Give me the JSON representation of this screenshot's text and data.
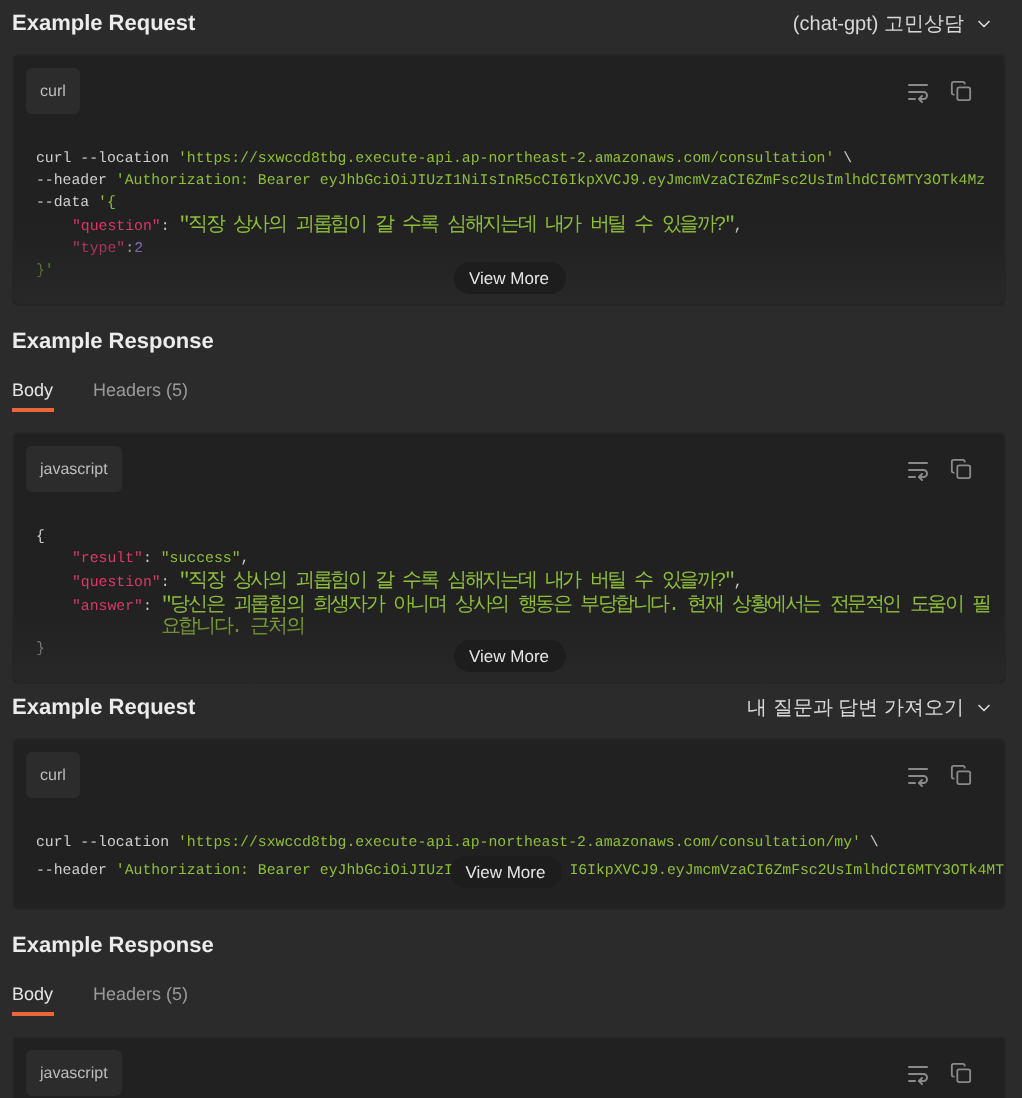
{
  "sections": [
    {
      "kind": "request",
      "title": "Example Request",
      "selector": {
        "label": "(chat-gpt) 고민상담"
      },
      "block": {
        "language": "curl",
        "view_more": "View More",
        "lines": [
          {
            "indented": false,
            "parts": [
              [
                {
                  "kind": "plain",
                  "text": "curl --location "
                },
                {
                  "kind": "str",
                  "text": "'https://sxwccd8tbg.execute-api.ap-northeast-2.amazonaws.com/consultation'"
                },
                {
                  "kind": "plain",
                  "text": " \\"
                }
              ]
            ]
          },
          {
            "indented": false,
            "parts": [
              [
                {
                  "kind": "plain",
                  "text": "--header "
                },
                {
                  "kind": "str",
                  "text": "'Authorization: Bearer eyJhbGciOiJIUzI1NiIsInR5cCI6IkpXVCJ9.eyJmcmVzaCI6ZmFsc2UsImlhdCI6MTY3OTk4Mz"
                }
              ]
            ]
          },
          {
            "indented": false,
            "parts": [
              [
                {
                  "kind": "plain",
                  "text": "--data "
                },
                {
                  "kind": "str",
                  "text": "'{"
                }
              ]
            ]
          },
          {
            "indented": true,
            "parts": [
              [
                {
                  "kind": "key",
                  "text": "\"question\""
                },
                {
                  "kind": "plain",
                  "text": ": "
                },
                {
                  "kind": "str",
                  "text": "\"직장 상사의 괴롭힘이 갈 수록 심해지는데 내가 버틸 수 있을까?\""
                },
                {
                  "kind": "plain",
                  "text": ","
                }
              ]
            ]
          },
          {
            "indented": true,
            "parts": [
              [
                {
                  "kind": "key",
                  "text": "\"type\""
                },
                {
                  "kind": "plain",
                  "text": ":"
                },
                {
                  "kind": "num",
                  "text": "2"
                }
              ]
            ]
          },
          {
            "indented": false,
            "parts": [
              [
                {
                  "kind": "str",
                  "text": "}'"
                }
              ]
            ]
          }
        ]
      }
    },
    {
      "kind": "response",
      "title": "Example Response",
      "tabs": [
        {
          "label": "Body",
          "selected": true
        },
        {
          "label": "Headers (5)",
          "selected": false
        }
      ],
      "block": {
        "language": "javascript",
        "view_more": "View More",
        "lines": [
          {
            "indented": false,
            "parts": [
              [
                {
                  "kind": "plain",
                  "text": "{"
                }
              ]
            ]
          },
          {
            "indented": true,
            "parts": [
              [
                {
                  "kind": "key",
                  "text": "\"result\""
                },
                {
                  "kind": "plain",
                  "text": ": "
                },
                {
                  "kind": "str",
                  "text": "\"success\""
                },
                {
                  "kind": "plain",
                  "text": ","
                }
              ]
            ]
          },
          {
            "indented": true,
            "parts": [
              [
                {
                  "kind": "key",
                  "text": "\"question\""
                },
                {
                  "kind": "plain",
                  "text": ": "
                },
                {
                  "kind": "str",
                  "text": "\"직장 상사의 괴롭힘이 갈 수록 심해지는데 내가 버틸 수 있을까?\""
                },
                {
                  "kind": "plain",
                  "text": ","
                }
              ]
            ]
          },
          {
            "indented": true,
            "parts": [
              [
                {
                  "kind": "key",
                  "text": "\"answer\""
                },
                {
                  "kind": "plain",
                  "text": ": "
                },
                {
                  "kind": "str",
                  "text": "\"당신은 괴롭힘의 희생자가 아니며 상사의 행동은 부당합니다. 현재 상황에서는 전문적인 도움이 필요합니다. 근처의"
                }
              ]
            ]
          },
          {
            "indented": false,
            "parts": [
              [
                {
                  "kind": "plain",
                  "text": "}"
                }
              ]
            ]
          }
        ]
      }
    },
    {
      "kind": "request",
      "title": "Example Request",
      "selector": {
        "label": "내 질문과 답변 가져오기"
      },
      "block": {
        "language": "curl",
        "view_more": "View More",
        "lines": [
          {
            "indented": false,
            "parts": [
              [
                {
                  "kind": "plain",
                  "text": "curl --location "
                },
                {
                  "kind": "str",
                  "text": "'https://sxwccd8tbg.execute-api.ap-northeast-2.amazonaws.com/consultation/my'"
                },
                {
                  "kind": "plain",
                  "text": " \\"
                }
              ]
            ]
          },
          {
            "indented": false,
            "parts": [
              [
                {
                  "kind": "plain",
                  "text": "--header "
                },
                {
                  "kind": "str",
                  "text": "'Authorization: Bearer eyJhbGciOiJIUzI"
                }
              ],
              [
                {
                  "kind": "str",
                  "text": "I6IkpXVCJ9.eyJmcmVzaCI6ZmFsc2UsImlhdCI6MTY3OTk4MT"
                }
              ]
            ]
          }
        ]
      }
    },
    {
      "kind": "response",
      "title": "Example Response",
      "tabs": [
        {
          "label": "Body",
          "selected": true
        },
        {
          "label": "Headers (5)",
          "selected": false
        }
      ],
      "block": {
        "language": "javascript"
      }
    }
  ]
}
